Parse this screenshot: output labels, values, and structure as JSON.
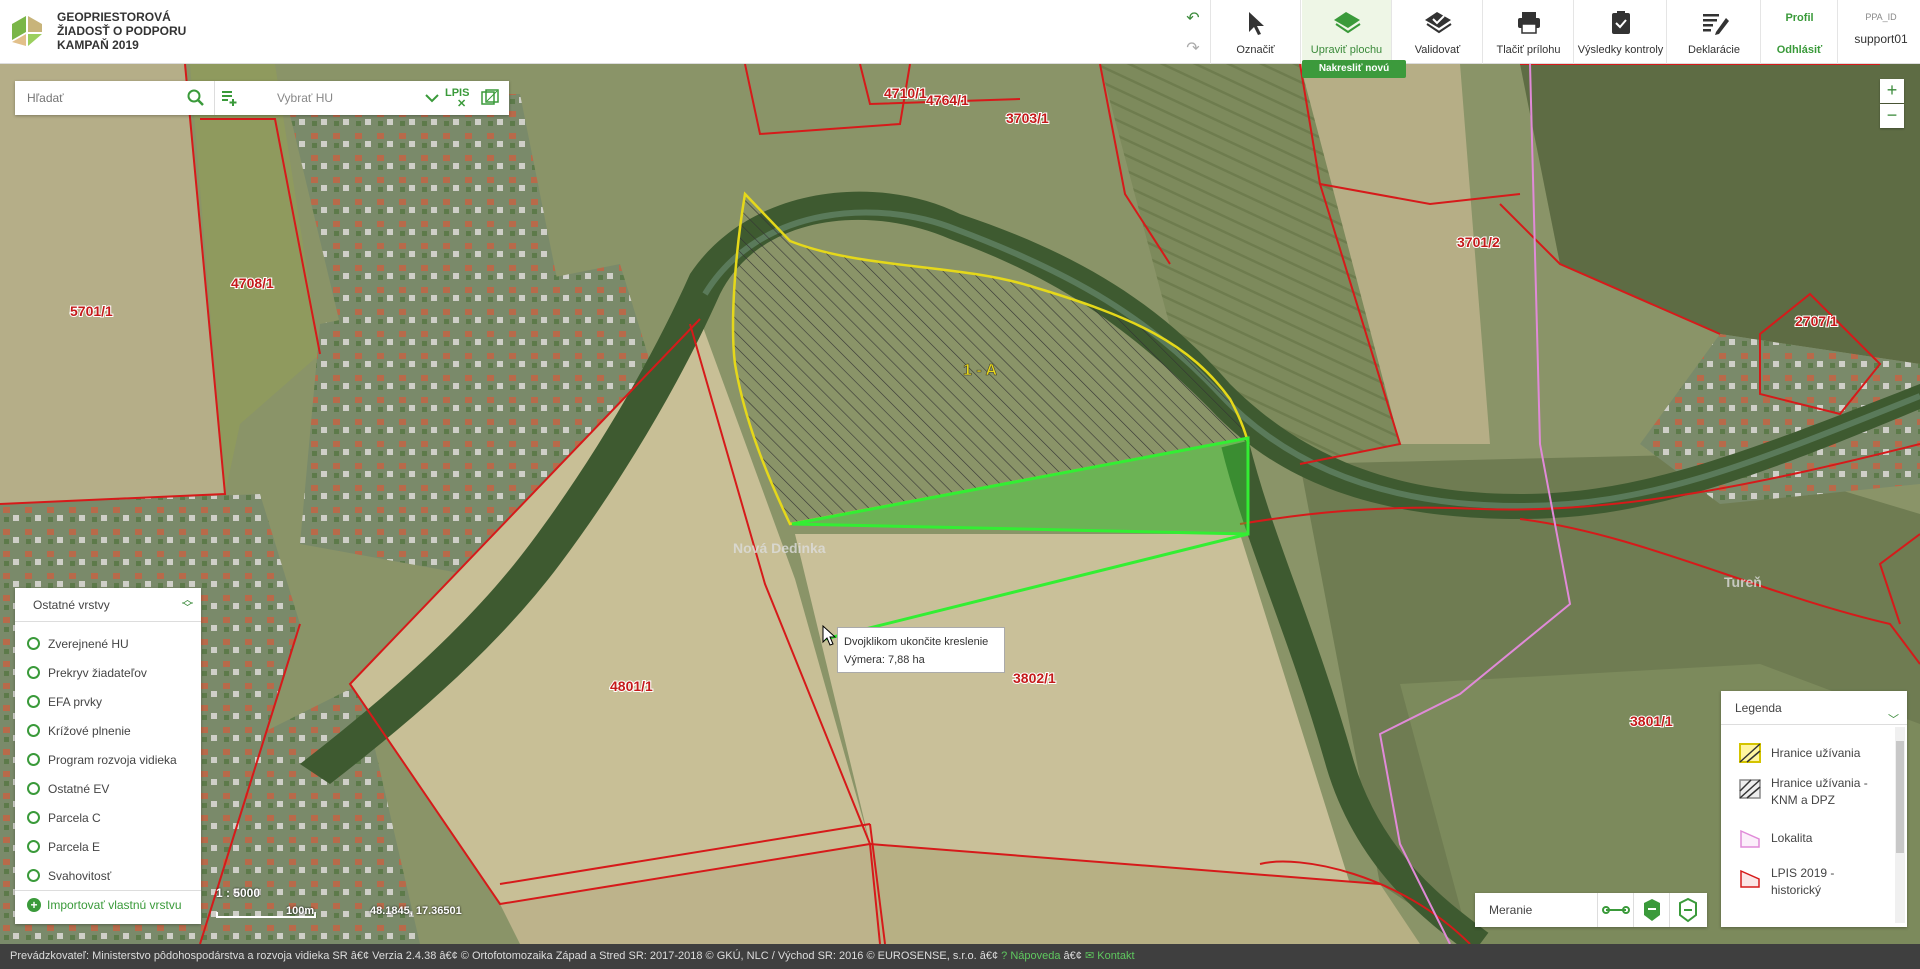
{
  "header": {
    "title_line1": "GEOPRIESTOROVÁ",
    "title_line2": "ŽIADOSŤ O PODPORU",
    "title_line3": "KAMPAŇ 2019",
    "undo_icon": "undo-icon",
    "redo_icon": "redo-icon",
    "tools": [
      {
        "label": "Označiť",
        "icon": "cursor-icon",
        "active": false
      },
      {
        "label": "Upraviť plochu",
        "icon": "edit-area-icon",
        "active": true
      },
      {
        "label": "Validovať",
        "icon": "validate-icon",
        "active": false
      },
      {
        "label": "Tlačiť prílohu",
        "icon": "print-icon",
        "active": false
      },
      {
        "label": "Výsledky kontroly",
        "icon": "clipboard-check-icon",
        "active": false
      },
      {
        "label": "Deklarácie",
        "icon": "declaration-icon",
        "active": false
      }
    ],
    "active_badge": "Nakresliť novú",
    "profile_label": "Profil",
    "logout_label": "Odhlásiť",
    "user_id_label": "PPA_ID",
    "username": "support01"
  },
  "search": {
    "placeholder": "Hľadať",
    "hu_select_placeholder": "Vybrať HU",
    "lpis_label": "LPIS"
  },
  "zoom": {
    "in": "+",
    "out": "−"
  },
  "layers_panel": {
    "title": "Ostatné vrstvy",
    "items": [
      "Zverejnené HU",
      "Prekryv žiadateľov",
      "EFA prvky",
      "Krížové plnenie",
      "Program rozvoja vidieka",
      "Ostatné EV",
      "Parcela C",
      "Parcela E",
      "Svahovitosť"
    ],
    "import_label": "Importovať vlastnú vrstvu"
  },
  "map": {
    "parcel_labels": [
      "4710/1",
      "4764/1",
      "3703/1",
      "3701/2",
      "2707/1",
      "5701/1",
      "4708/1",
      "4801/1",
      "3802/1",
      "3801/1"
    ],
    "partial_label_left": "/1",
    "place_labels": [
      "Nová Dedinka",
      "Tureň"
    ],
    "field_label": "1 - A",
    "scale": "1 : 5000",
    "scale_bar_label": "100m",
    "coordinates": "48.1845, 17.36501"
  },
  "tooltip": {
    "line1": "Dvojklikom ukončite kreslenie",
    "line2": "Výmera: 7,88 ha"
  },
  "measure": {
    "label": "Meranie"
  },
  "legend": {
    "title": "Legenda",
    "items": [
      "Hranice užívania",
      "Hranice užívania - KNM a DPZ",
      "Lokalita",
      "LPIS 2019 - historický"
    ]
  },
  "footer": {
    "text": "Prevádzkovateľ: Ministerstvo pôdohospodárstva a rozvoja vidieka SR â€¢ Verzia 2.4.38 â€¢ © Ortofotomozaika Západ a Stred SR: 2017-2018 © GKÚ, NLC / Východ SR: 2016 © EUROSENSE, s.r.o.  â€¢ ",
    "help_label": "Nápoveda",
    "separator": " â€¢ ",
    "contact_label": "Kontakt"
  },
  "colors": {
    "accent": "#3a9a3a",
    "parcel_border": "#d61a1a",
    "usage_border": "#e5d81a",
    "drawing": "#33ee33",
    "locality": "#e08ad8"
  }
}
